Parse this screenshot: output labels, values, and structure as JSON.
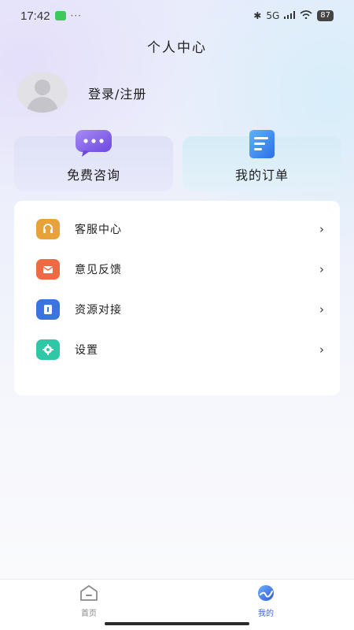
{
  "status_bar": {
    "time": "17:42",
    "dots": "···",
    "signal_text": "5G",
    "battery": "87"
  },
  "header": {
    "title": "个人中心"
  },
  "profile": {
    "login_label": "登录/注册"
  },
  "quick_actions": [
    {
      "label": "免费咨询",
      "icon": "chat-bubble-icon"
    },
    {
      "label": "我的订单",
      "icon": "document-icon"
    }
  ],
  "menu": {
    "items": [
      {
        "label": "客服中心",
        "icon": "headset-icon",
        "arrow": "›",
        "color": "#e8a23a"
      },
      {
        "label": "意见反馈",
        "icon": "feedback-icon",
        "arrow": "›",
        "color": "#ee6a42"
      },
      {
        "label": "资源对接",
        "icon": "resource-icon",
        "arrow": "›",
        "color": "#3b73e0"
      },
      {
        "label": "设置",
        "icon": "gear-icon",
        "arrow": "›",
        "color": "#2fc7a6"
      }
    ]
  },
  "tabbar": {
    "tabs": [
      {
        "label": "首页",
        "icon": "home-icon",
        "active": false
      },
      {
        "label": "我的",
        "icon": "mine-icon",
        "active": true
      }
    ]
  },
  "colors": {
    "accent": "#3a64e0",
    "inactive_tab": "#8a8a8f"
  }
}
